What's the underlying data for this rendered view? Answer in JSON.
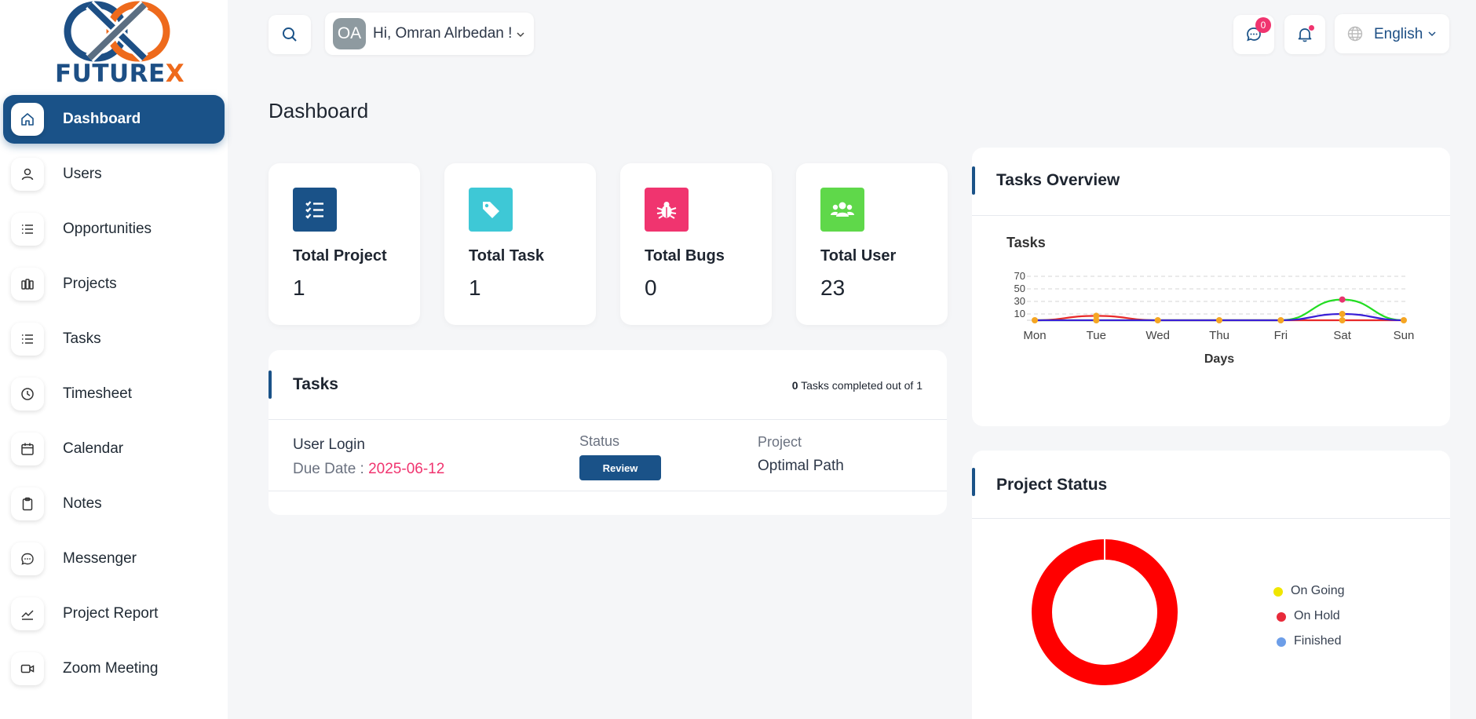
{
  "brand": {
    "name_main": "FUTURE",
    "name_accent": "X"
  },
  "sidebar": {
    "items": [
      {
        "label": "Dashboard",
        "icon": "home-icon",
        "active": true
      },
      {
        "label": "Users",
        "icon": "user-icon"
      },
      {
        "label": "Opportunities",
        "icon": "list-icon"
      },
      {
        "label": "Projects",
        "icon": "columns-icon"
      },
      {
        "label": "Tasks",
        "icon": "list-icon"
      },
      {
        "label": "Timesheet",
        "icon": "clock-icon"
      },
      {
        "label": "Calendar",
        "icon": "calendar-icon"
      },
      {
        "label": "Notes",
        "icon": "clipboard-icon"
      },
      {
        "label": "Messenger",
        "icon": "chat-icon"
      },
      {
        "label": "Project Report",
        "icon": "line-chart-icon"
      },
      {
        "label": "Zoom Meeting",
        "icon": "video-icon"
      }
    ]
  },
  "header": {
    "user_initials": "OA",
    "greeting": "Hi, Omran Alrbedan !",
    "messages_count": "0",
    "language": "English"
  },
  "page": {
    "title": "Dashboard"
  },
  "stats": [
    {
      "label": "Total Project",
      "value": "1",
      "icon": "checklist-icon",
      "color": "#1a5288"
    },
    {
      "label": "Total Task",
      "value": "1",
      "icon": "tag-icon",
      "color": "#3ec8d6"
    },
    {
      "label": "Total Bugs",
      "value": "0",
      "icon": "bug-icon",
      "color": "#f0346f"
    },
    {
      "label": "Total User",
      "value": "23",
      "icon": "users-icon",
      "color": "#5fd84a"
    }
  ],
  "tasks": {
    "title": "Tasks",
    "completed_count": "0",
    "completed_suffix": "Tasks completed out of 1",
    "rows": [
      {
        "name": "User Login",
        "due_label": "Due Date :",
        "due_date": "2025-06-12",
        "status_label": "Status",
        "status": "Review",
        "project_label": "Project",
        "project": "Optimal Path"
      }
    ]
  },
  "tasks_overview": {
    "title": "Tasks Overview"
  },
  "project_status": {
    "title": "Project Status",
    "legend": [
      {
        "label": "On Going",
        "color": "#f0e600"
      },
      {
        "label": "On Hold",
        "color": "#e82a3a"
      },
      {
        "label": "Finished",
        "color": "#6d9ee8"
      }
    ]
  },
  "chart_data": [
    {
      "type": "line",
      "title": "Tasks",
      "xlabel": "Days",
      "ylabel": "",
      "categories": [
        "Mon",
        "Tue",
        "Wed",
        "Thu",
        "Fri",
        "Sat",
        "Sun"
      ],
      "yticks": [
        10,
        30,
        50,
        70
      ],
      "ylim": [
        0,
        75
      ],
      "grid": true,
      "series": [
        {
          "color": "#e82a2a",
          "values": [
            0,
            7,
            0,
            0,
            0,
            0,
            0
          ]
        },
        {
          "color": "#22dd22",
          "values": [
            0,
            0,
            0,
            0,
            0,
            33,
            0
          ]
        },
        {
          "color": "#3a1fd6",
          "values": [
            0,
            0,
            0,
            0,
            0,
            10,
            0
          ]
        }
      ]
    },
    {
      "type": "pie",
      "variant": "donut",
      "labels": [
        "On Going",
        "On Hold",
        "Finished"
      ],
      "values": [
        0,
        1,
        0
      ],
      "colors": [
        "#f0e600",
        "#ff0000",
        "#6d9ee8"
      ]
    }
  ]
}
